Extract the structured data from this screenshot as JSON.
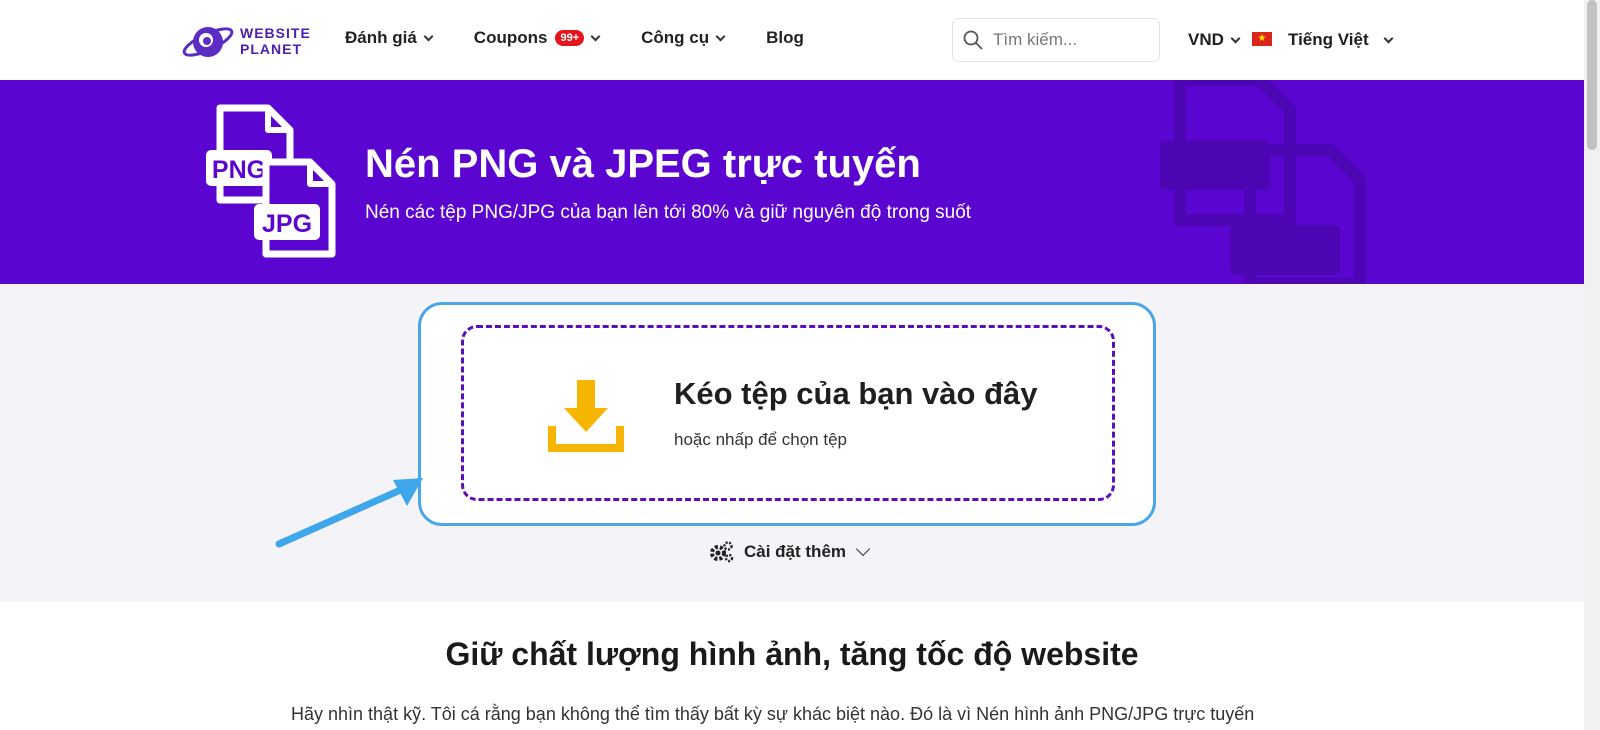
{
  "header": {
    "logo_text_line1": "WEBSITE",
    "logo_text_line2": "PLANET",
    "nav": [
      {
        "label": "Đánh giá"
      },
      {
        "label": "Coupons",
        "badge": "99+"
      },
      {
        "label": "Công cụ"
      },
      {
        "label": "Blog"
      }
    ],
    "search_placeholder": "Tìm kiếm...",
    "currency": "VND",
    "language": "Tiếng Việt"
  },
  "hero": {
    "icon_labels": [
      "PNG",
      "JPG"
    ],
    "title": "Nén PNG và JPEG trực tuyến",
    "subtitle": "Nén các tệp PNG/JPG của bạn lên tới 80% và giữ nguyên độ trong suốt"
  },
  "upload": {
    "title": "Kéo tệp của bạn vào đây",
    "subtitle": "hoặc nhấp để chọn tệp",
    "settings_label": "Cài đặt thêm"
  },
  "content": {
    "heading": "Giữ chất lượng hình ảnh, tăng tốc độ website",
    "paragraph": "Hãy nhìn thật kỹ. Tôi cá rằng bạn không thể tìm thấy bất kỳ sự khác biệt nào. Đó là vì Nén hình ảnh PNG/JPG trực tuyến"
  },
  "colors": {
    "brand_purple": "#5a06d0",
    "badge_red": "#e4151f",
    "upload_border_blue": "#4aa6e6",
    "download_icon_yellow": "#f6b500"
  }
}
